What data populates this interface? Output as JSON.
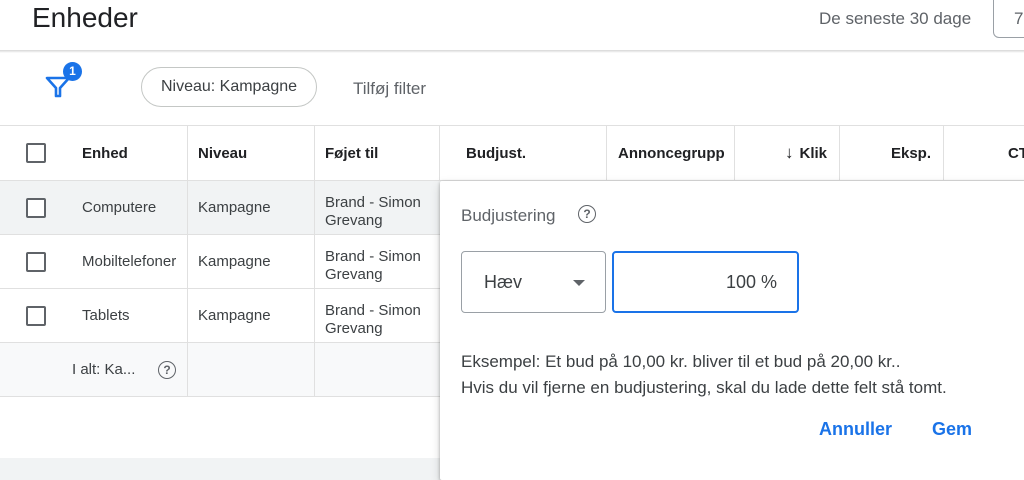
{
  "header": {
    "title": "Enheder",
    "date_range_label": "De seneste 30 dage",
    "date_box_value": "7"
  },
  "filter_bar": {
    "filter_icon": "funnel-icon",
    "filter_count": "1",
    "chip_label": "Niveau: Kampagne",
    "add_filter_label": "Tilføj filter"
  },
  "table": {
    "columns": [
      "Enhed",
      "Niveau",
      "Føjet til",
      "Budjust.",
      "Annoncegruppe",
      "Klik",
      "Eksp.",
      "CT"
    ],
    "sort_icon": "arrow-down-icon",
    "rows": [
      {
        "enhed": "Computere",
        "niveau": "Kampagne",
        "foejet_til": "Brand - Simon Grevang"
      },
      {
        "enhed": "Mobiltelefoner",
        "niveau": "Kampagne",
        "foejet_til": "Brand - Simon Grevang"
      },
      {
        "enhed": "Tablets",
        "niveau": "Kampagne",
        "foejet_til": "Brand - Simon Grevang"
      }
    ],
    "total_label": "I alt: Ka...",
    "help_glyph": "?"
  },
  "popup": {
    "title": "Budjustering",
    "help_glyph": "?",
    "select_value": "Hæv",
    "percent_value": "100 %",
    "example_line1": "Eksempel: Et bud på 10,00 kr. bliver til et bud på 20,00 kr..",
    "example_line2": "Hvis du vil fjerne en budjustering, skal du lade dette felt stå tomt.",
    "cancel_label": "Annuller",
    "save_label": "Gem"
  },
  "colors": {
    "accent": "#1a73e8",
    "text": "#202124",
    "muted": "#5f6368",
    "selected_row": "#f1f3f4"
  }
}
